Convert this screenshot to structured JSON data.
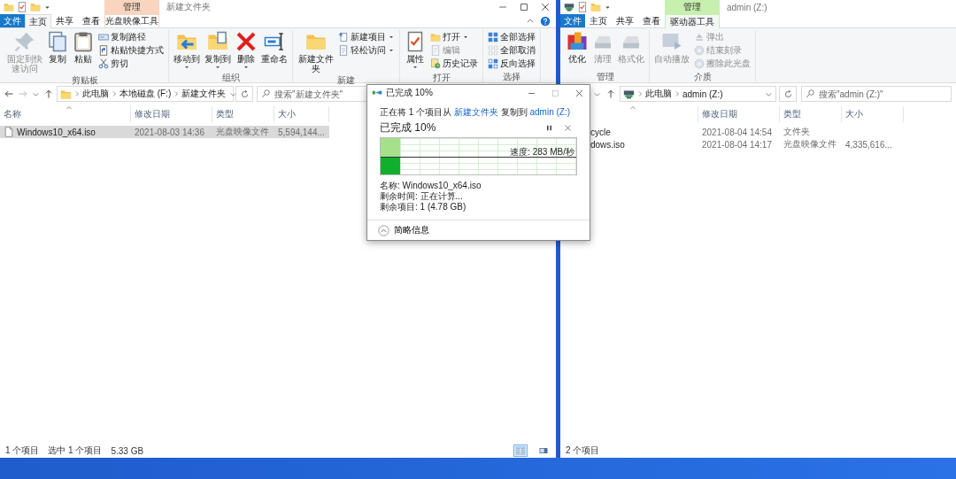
{
  "left_window": {
    "contextual_header": {
      "label": "管理",
      "color": "#f9d4bf"
    },
    "title": "新建文件夹",
    "tabs": [
      {
        "label": "文件",
        "kind": "file",
        "selected": false
      },
      {
        "label": "主页",
        "kind": "tab",
        "selected": true
      },
      {
        "label": "共享",
        "kind": "tab",
        "selected": false
      },
      {
        "label": "查看",
        "kind": "tab",
        "selected": false
      },
      {
        "label": "光盘映像工具",
        "kind": "tool",
        "selected": false
      }
    ],
    "ribbon_groups": [
      {
        "label": "剪贴板",
        "items": [
          {
            "label": "固定到快速访问",
            "kind": "large",
            "disabled": true,
            "dropdown": false
          },
          {
            "label": "复制",
            "kind": "large",
            "disabled": false,
            "dropdown": false
          },
          {
            "label": "粘贴",
            "kind": "large",
            "disabled": false,
            "dropdown": false
          },
          {
            "label": "复制路径",
            "kind": "small",
            "disabled": false,
            "dropdown": false
          },
          {
            "label": "粘贴快捷方式",
            "kind": "small",
            "disabled": false,
            "dropdown": false
          },
          {
            "label": "剪切",
            "kind": "small",
            "disabled": false,
            "dropdown": false
          }
        ]
      },
      {
        "label": "组织",
        "items": [
          {
            "label": "移动到",
            "kind": "large",
            "disabled": false,
            "dropdown": true
          },
          {
            "label": "复制到",
            "kind": "large",
            "disabled": false,
            "dropdown": true
          },
          {
            "label": "删除",
            "kind": "large",
            "disabled": false,
            "dropdown": true
          },
          {
            "label": "重命名",
            "kind": "large",
            "disabled": false,
            "dropdown": false
          }
        ]
      },
      {
        "label": "新建",
        "items": [
          {
            "label": "新建文件夹",
            "kind": "large",
            "disabled": false,
            "dropdown": false
          },
          {
            "label": "新建项目",
            "kind": "small",
            "disabled": false,
            "dropdown": true
          },
          {
            "label": "轻松访问",
            "kind": "small",
            "disabled": false,
            "dropdown": true
          }
        ]
      },
      {
        "label": "打开",
        "items": [
          {
            "label": "属性",
            "kind": "large",
            "disabled": false,
            "dropdown": true
          },
          {
            "label": "打开",
            "kind": "small",
            "disabled": false,
            "dropdown": true
          },
          {
            "label": "编辑",
            "kind": "small",
            "disabled": true,
            "dropdown": false
          },
          {
            "label": "历史记录",
            "kind": "small",
            "disabled": false,
            "dropdown": false
          }
        ]
      },
      {
        "label": "选择",
        "items": [
          {
            "label": "全部选择",
            "kind": "small",
            "disabled": false,
            "dropdown": false
          },
          {
            "label": "全部取消",
            "kind": "small",
            "disabled": false,
            "dropdown": false
          },
          {
            "label": "反向选择",
            "kind": "small",
            "disabled": false,
            "dropdown": false
          }
        ]
      }
    ],
    "breadcrumbs": [
      "此电脑",
      "本地磁盘 (F:)",
      "新建文件夹"
    ],
    "search": {
      "placeholder": "搜索\"新建文件夹\""
    },
    "columns": [
      "名称",
      "修改日期",
      "类型",
      "大小"
    ],
    "rows": [
      {
        "name": "Windows10_x64.iso",
        "date": "2021-08-03 14:36",
        "type": "光盘映像文件",
        "size": "5,594,144...",
        "selected": true
      }
    ],
    "status_bar": [
      "1 个项目",
      "选中 1 个项目",
      "5.33 GB"
    ],
    "view_buttons": [
      {
        "selected": true
      },
      {
        "selected": false
      }
    ]
  },
  "right_window": {
    "contextual_header": {
      "label": "管理",
      "color": "#c7efad"
    },
    "title": "admin (Z:)",
    "tabs": [
      {
        "label": "文件",
        "kind": "file",
        "selected": false
      },
      {
        "label": "主页",
        "kind": "tab",
        "selected": false
      },
      {
        "label": "共享",
        "kind": "tab",
        "selected": false
      },
      {
        "label": "查看",
        "kind": "tab",
        "selected": false
      },
      {
        "label": "驱动器工具",
        "kind": "tool",
        "selected": true
      }
    ],
    "ribbon_groups": [
      {
        "label": "管理",
        "items": [
          {
            "label": "优化",
            "kind": "large",
            "disabled": false,
            "dropdown": false
          },
          {
            "label": "清理",
            "kind": "large",
            "disabled": true,
            "dropdown": false
          },
          {
            "label": "格式化",
            "kind": "large",
            "disabled": true,
            "dropdown": false
          }
        ]
      },
      {
        "label": "介质",
        "items": [
          {
            "label": "自动播放",
            "kind": "large",
            "disabled": true,
            "dropdown": false
          },
          {
            "label": "弹出",
            "kind": "small",
            "disabled": true,
            "dropdown": false
          },
          {
            "label": "结束刻录",
            "kind": "small",
            "disabled": true,
            "dropdown": false
          },
          {
            "label": "擦除此光盘",
            "kind": "small",
            "disabled": true,
            "dropdown": false
          }
        ]
      }
    ],
    "breadcrumbs": [
      "此电脑",
      "admin (Z:)"
    ],
    "search": {
      "placeholder": "搜索\"admin (Z:)\""
    },
    "columns": [
      "修改日期",
      "类型",
      "大小"
    ],
    "rows": [
      {
        "name": "cycle",
        "date": "2021-08-04 14:54",
        "type": "文件夹",
        "selected": false
      },
      {
        "name": "dows.iso",
        "date": "2021-08-04 14:17",
        "type": "光盘映像文件",
        "size": "4,335,616...",
        "selected": false
      }
    ],
    "status_bar": [
      "2 个项目"
    ]
  },
  "copy_dialog": {
    "title": "已完成 10%",
    "status_line": {
      "prefix": "正在将 1 个项目从",
      "source": "新建文件夹",
      "middle": "复制到",
      "destination": "admin (Z:)"
    },
    "heading": "已完成 10%",
    "level": 0.1,
    "speed": "速度: 283 MB/秒",
    "details": [
      "名称: Windows10_x64.iso",
      "剩余时间: 正在计算...",
      "剩余项目: 1 (4.78 GB)"
    ],
    "toggle": "简略信息"
  }
}
